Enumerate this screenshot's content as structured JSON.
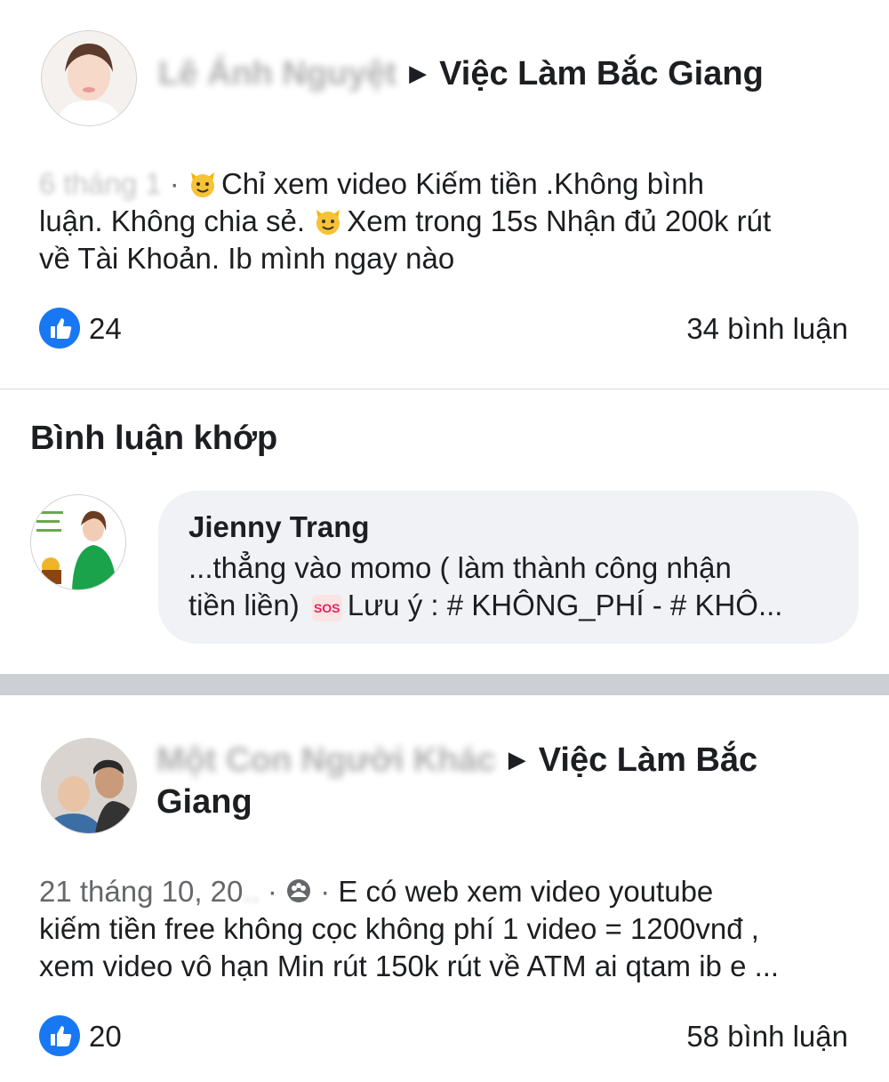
{
  "post1": {
    "author_blurred": "Lê Ánh Nguyệt",
    "group_name": "Việc Làm Bắc Giang",
    "meta_blurred": "6 tháng 1",
    "text_line1": "Chỉ xem video Kiếm tiền .Không bình",
    "text_line2a": "luận. Không chia sẻ.",
    "text_line2b": "Xem trong 15s Nhận đủ 200k rút",
    "text_line3": "về Tài Khoản. Ib mình ngay nào",
    "likes": "24",
    "comments": "34 bình luận"
  },
  "matched_comments": {
    "title": "Bình luận khớp",
    "commenter_name": "Jienny Trang",
    "comment_line1": "...thẳng vào momo ( làm thành công nhận",
    "comment_line2a": "tiền liền)",
    "comment_line2b": "Lưu ý : # KHÔNG_PHÍ - # KHÔ..."
  },
  "post2": {
    "author_blurred": "Một Con Người Khác",
    "group_name_line1": "Việc Làm Bắc",
    "group_name_line2": "Giang",
    "date_partial": "21 tháng 10, 20",
    "text_line1": "E có web xem video youtube",
    "text_line2": "kiếm tiền free không cọc không phí 1 video = 1200vnđ ,",
    "text_line3": "xem video vô hạn Min rút 150k rút về ATM ai qtam ib e ...",
    "likes": "20",
    "comments": "58 bình luận"
  },
  "icons": {
    "like": "thumbs-up-icon",
    "privacy": "group-audience-icon",
    "emoji_cat": "smiley-cat-emoji",
    "sos": "sos-emoji"
  },
  "colors": {
    "like_blue": "#1877f2",
    "separator": "#ccd0d5",
    "bubble": "#f0f2f5"
  }
}
